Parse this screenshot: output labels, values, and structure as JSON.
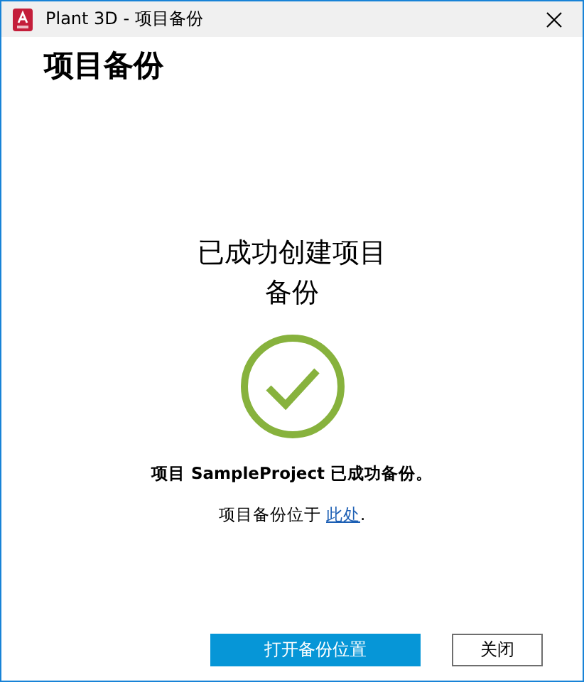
{
  "window": {
    "title": "Plant 3D - 项目备份"
  },
  "heading": "项目备份",
  "status": {
    "title": "已成功创建项目备份",
    "message": "项目 SampleProject 已成功备份。",
    "location_prefix": "项目备份位于",
    "location_link": "此处",
    "location_suffix": "."
  },
  "buttons": [
    {
      "label": "打开备份位置",
      "kind": "primary"
    },
    {
      "label": "关闭",
      "kind": "secondary"
    }
  ]
}
